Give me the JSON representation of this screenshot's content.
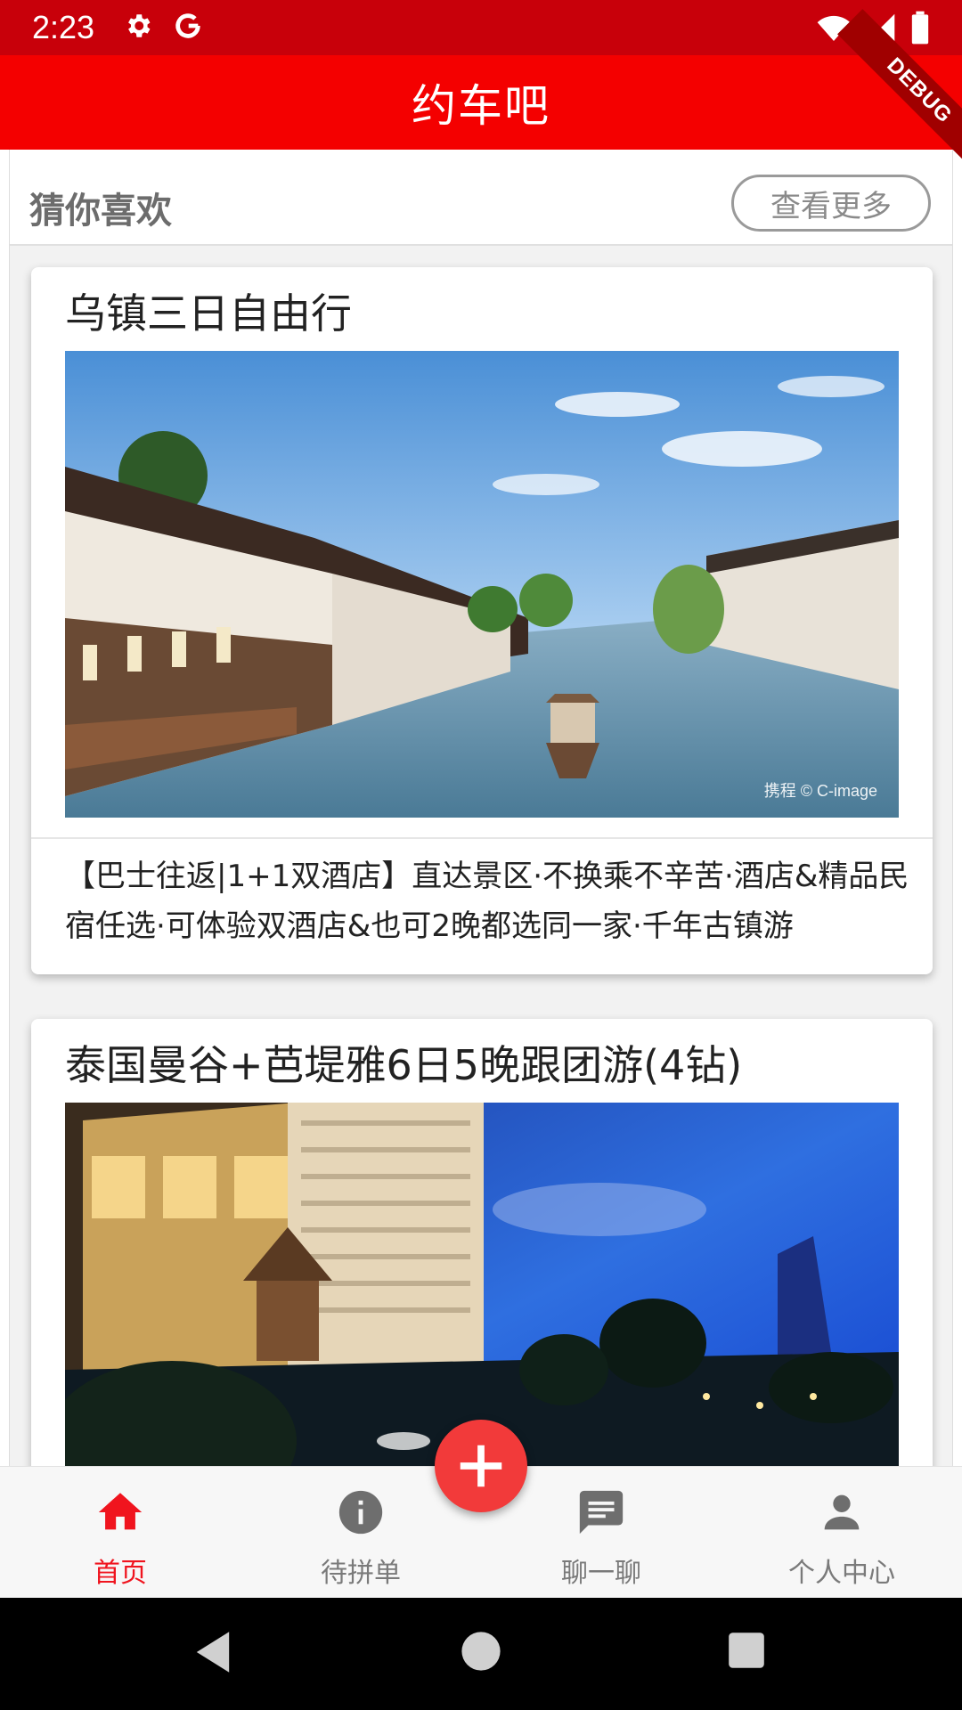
{
  "status_bar": {
    "time": "2:23",
    "background": "#c8000a",
    "icons_left": [
      "gear-icon",
      "google-icon"
    ],
    "icons_right": [
      "wifi-icon",
      "signal-icon",
      "battery-icon"
    ]
  },
  "app_bar": {
    "title": "约车吧",
    "debug_badge": "DEBUG",
    "color": "#f40000"
  },
  "recommend": {
    "title": "猜你喜欢",
    "more_button": "查看更多"
  },
  "cards": [
    {
      "title": "乌镇三日自由行",
      "image_watermark": "携程 © C-image",
      "description": "【巴士往返|1+1双酒店】直达景区·不换乘不辛苦·酒店&精品民宿任选·可体验双酒店&也可2晚都选同一家·千年古镇游"
    },
    {
      "title": "泰国曼谷+芭堤雅6日5晚跟团游(4钻)"
    }
  ],
  "bottom_nav": {
    "items": [
      {
        "label": "首页",
        "icon": "home-icon",
        "active": true
      },
      {
        "label": "待拼单",
        "icon": "info-icon",
        "active": false
      },
      {
        "label": "聊一聊",
        "icon": "chat-icon",
        "active": false
      },
      {
        "label": "个人中心",
        "icon": "person-icon",
        "active": false
      }
    ],
    "fab_icon": "plus-icon",
    "accent": "#f0141e"
  },
  "system_nav": {
    "buttons": [
      "back-icon",
      "home-circle-icon",
      "recents-icon"
    ]
  }
}
